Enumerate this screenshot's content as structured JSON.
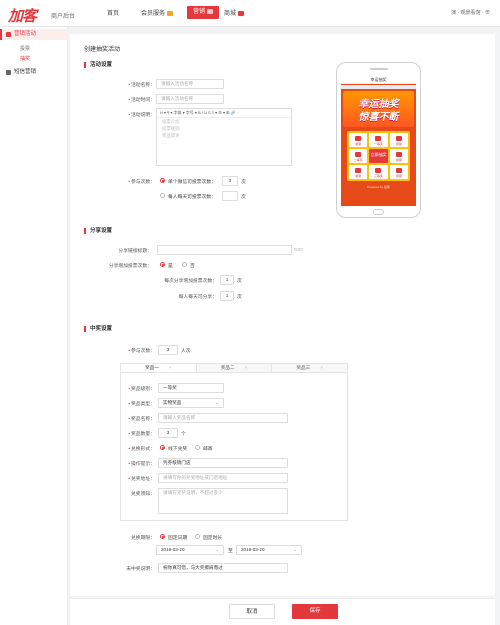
{
  "header": {
    "logo": "加客",
    "subtitle": "商户后台",
    "nav": [
      {
        "label": "首页"
      },
      {
        "label": "会员服务"
      },
      {
        "label": "营销"
      },
      {
        "label": "商城"
      }
    ],
    "user": "演 · 观景看馆 · ⊕"
  },
  "sidebar": {
    "groups": [
      {
        "label": "营销活动",
        "items": [
          {
            "label": "投票"
          },
          {
            "label": "抽奖"
          }
        ]
      },
      {
        "label": "短信营销",
        "items": []
      }
    ]
  },
  "page": {
    "title": "创建抽奖活动",
    "activity_section": "活动设置",
    "activity": {
      "name_label": "活动名称：",
      "name_placeholder": "请输入活动名称",
      "time_label": "活动时间：",
      "time_placeholder": "请输入活动名称",
      "desc_label": "活动说明：",
      "toolbar": "H ▾  ¶ ▾  字体  ▾  字号 ▾  B I U S  ≡ ▾  ☰ ▾  ⊞  🔗",
      "desc_lines": [
        "投票介绍",
        "投票规则",
        "奖品简述",
        "…"
      ],
      "count_label": "参与次数：",
      "opt1": "单个微信可投票次数：",
      "opt1_value": "3",
      "opt1_unit": "次",
      "opt2": "每人每天可投票次数：",
      "opt2_unit": "次"
    },
    "share_section": "分享设置",
    "share": {
      "title_label": "分享链接标题：",
      "title_note": "0/30",
      "bonus_label": "分享增加投票次数：",
      "yes": "是",
      "no": "否",
      "per_share_label": "每次分享增加投票次数：",
      "per_share_value": "1",
      "per_share_unit": "次",
      "daily_label": "每人每天可分享：",
      "daily_value": "1",
      "daily_unit": "次"
    },
    "prize_section": "中奖设置",
    "prize": {
      "count_label": "参与次数：",
      "count_value": "3",
      "count_unit": "人次",
      "tabs": [
        {
          "label": "奖品一"
        },
        {
          "label": "奖品二"
        },
        {
          "label": "奖品三"
        }
      ],
      "level_label": "奖品级别：",
      "level_value": "一等奖",
      "type_label": "奖品类型：",
      "type_value": "实物奖品",
      "name_label": "奖品名称：",
      "name_placeholder": "请输入奖品名称",
      "qty_label": "奖品数量：",
      "qty_value": "3",
      "qty_unit": "个",
      "redeem_label": "兑换形式：",
      "redeem_opt1": "线下兑奖",
      "redeem_opt2": "邮寄",
      "hint_label": "操作提示：",
      "hint_value": "凭券核销门店",
      "addr_label": "兑奖地址：",
      "addr_placeholder": "请填写你的兑奖地址或门店地址",
      "notice_label": "兑奖须知：",
      "notice_placeholder": "请填写兑奖说明，不超过多少",
      "period_label": "兑换期限：",
      "period_opt1": "固定日期",
      "period_opt2": "固定时长",
      "date_from": "2018-03-20",
      "date_sep": "至",
      "date_to": "2019-03-20",
      "unwon_label": "未中奖说明：",
      "unwon_value": "祝你真可惜，与大奖擦肩而过"
    }
  },
  "preview": {
    "header": "幸运抽奖",
    "line1": "幸运抽奖",
    "line2": "惊喜不断",
    "center": "立即抽奖",
    "footer": "Powered by 加客",
    "cells": [
      "谢谢",
      "一等奖",
      "谢谢",
      "二等奖",
      "谢谢",
      "谢谢",
      "三等奖",
      "谢谢"
    ]
  },
  "footer": {
    "cancel": "取消",
    "save": "保存"
  },
  "colors": {
    "accent": "#e4393c",
    "sidebar_selected_bg": "#fdeeee"
  }
}
